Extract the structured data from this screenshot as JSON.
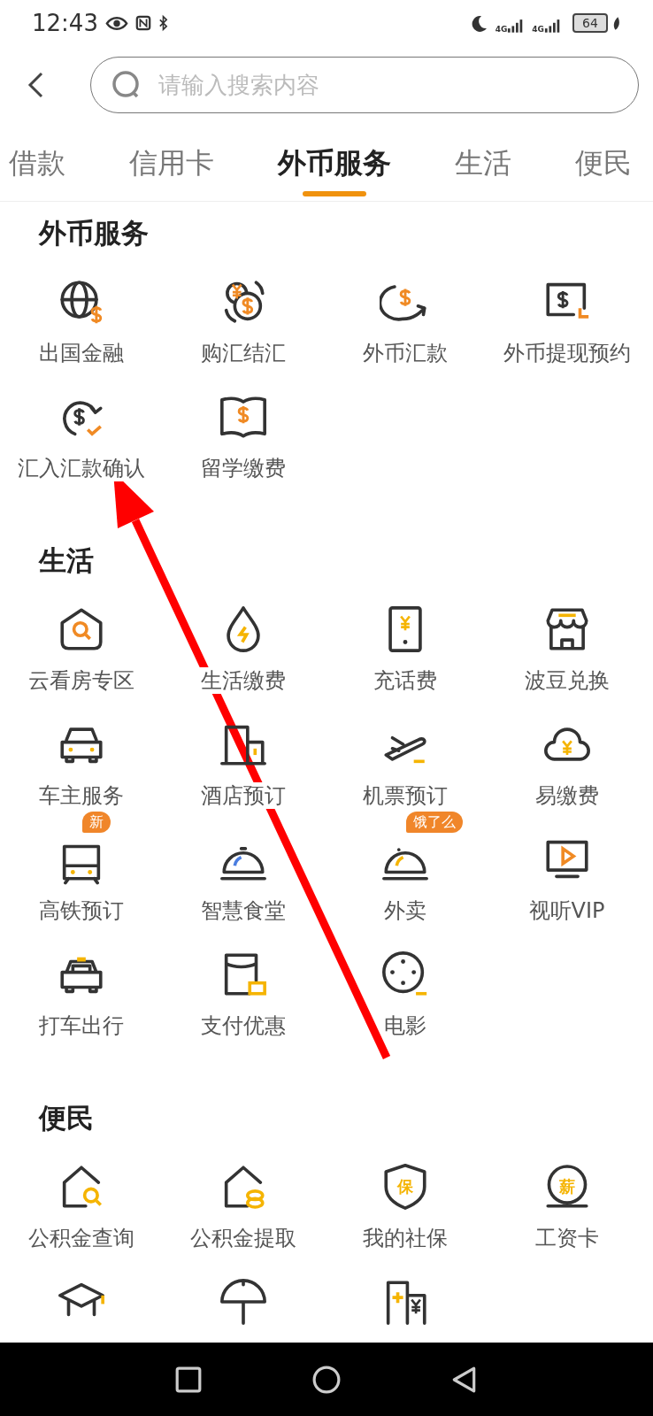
{
  "status_bar": {
    "time": "12:43",
    "network_labels": [
      "4G",
      "4G"
    ],
    "battery": "64"
  },
  "search": {
    "placeholder": "请输入搜索内容"
  },
  "tabs": [
    {
      "label": "借款",
      "selected": false
    },
    {
      "label": "信用卡",
      "selected": false
    },
    {
      "label": "外币服务",
      "selected": true
    },
    {
      "label": "生活",
      "selected": false
    },
    {
      "label": "便民",
      "selected": false
    }
  ],
  "sections": [
    {
      "title": "外币服务",
      "items": [
        {
          "label": "出国金融"
        },
        {
          "label": "购汇结汇"
        },
        {
          "label": "外币汇款"
        },
        {
          "label": "外币提现预约"
        },
        {
          "label": "汇入汇款确认"
        },
        {
          "label": "留学缴费"
        }
      ]
    },
    {
      "title": "生活",
      "items": [
        {
          "label": "云看房专区"
        },
        {
          "label": "生活缴费"
        },
        {
          "label": "充话费"
        },
        {
          "label": "波豆兑换"
        },
        {
          "label": "车主服务"
        },
        {
          "label": "酒店预订"
        },
        {
          "label": "机票预订"
        },
        {
          "label": "易缴费"
        },
        {
          "label": "高铁预订",
          "badge": "新"
        },
        {
          "label": "智慧食堂"
        },
        {
          "label": "外卖",
          "badge": "饿了么"
        },
        {
          "label": "视听VIP"
        },
        {
          "label": "打车出行"
        },
        {
          "label": "支付优惠"
        },
        {
          "label": "电影"
        }
      ]
    },
    {
      "title": "便民",
      "items": [
        {
          "label": "公积金查询"
        },
        {
          "label": "公积金提取"
        },
        {
          "label": "我的社保",
          "icon_text": "保"
        },
        {
          "label": "工资卡",
          "icon_text": "薪"
        }
      ]
    }
  ]
}
